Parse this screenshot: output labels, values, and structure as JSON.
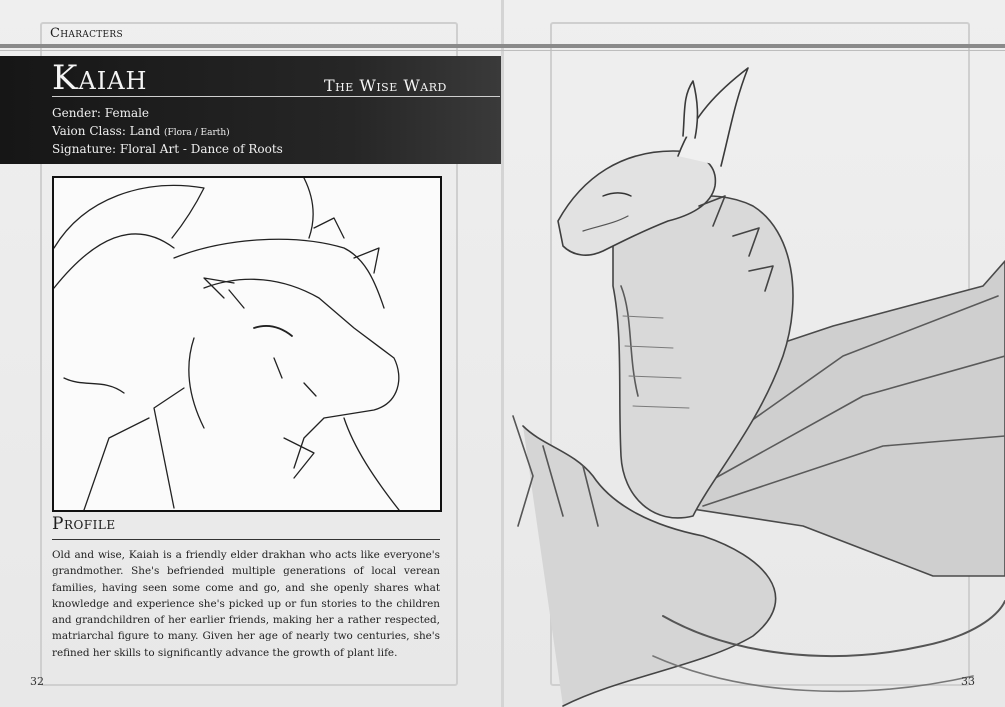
{
  "header": {
    "section": "Characters"
  },
  "character": {
    "name": "Kaiah",
    "title": "The Wise Ward",
    "gender_line": "Gender: Female",
    "class_line": "Vaion Class: Land",
    "class_detail": "(Flora / Earth)",
    "signature_line": "Signature: Floral Art - Dance of Roots"
  },
  "profile": {
    "heading": "Profile",
    "text": "Old and wise, Kaiah is a friendly elder drakhan who acts like everyone's grandmother. She's befriended multiple generations of local verean families, having seen some come and go, and she openly shares what knowledge and experience she's picked up or fun stories to the children and grandchildren of her earlier friends, making her a rather respected, matriarchal figure to many. Given her age of nearly two centuries, she's refined her skills to significantly advance the growth of plant life."
  },
  "pages": {
    "left": "32",
    "right": "33"
  }
}
